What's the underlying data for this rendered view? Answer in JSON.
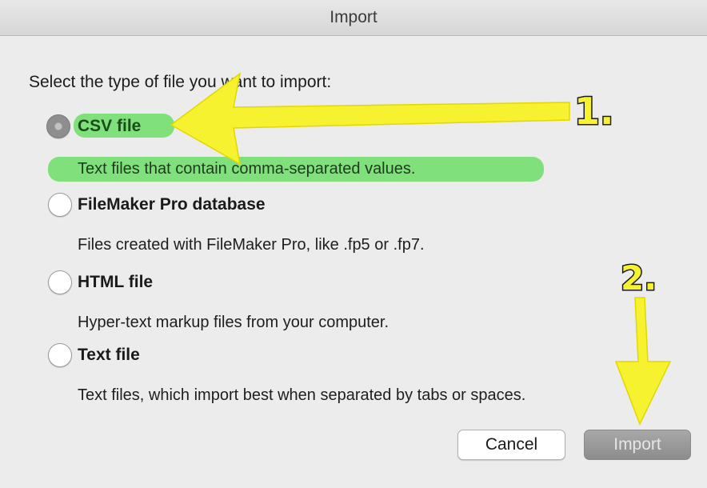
{
  "window": {
    "title": "Import"
  },
  "dialog": {
    "prompt": "Select the type of file you want to import:",
    "options": [
      {
        "title": "CSV file",
        "description": "Text files that contain comma-separated values.",
        "selected": true
      },
      {
        "title": "FileMaker Pro database",
        "description": "Files created with FileMaker Pro, like .fp5 or .fp7.",
        "selected": false
      },
      {
        "title": "HTML file",
        "description": "Hyper-text markup files from your computer.",
        "selected": false
      },
      {
        "title": "Text file",
        "description": "Text files, which import best when separated by tabs or spaces.",
        "selected": false
      }
    ],
    "buttons": {
      "cancel": "Cancel",
      "import": "Import"
    }
  },
  "annotations": {
    "step1": "1.",
    "step2": "2.",
    "highlight_color": "#7fe07c",
    "arrow_color": "#f6f230"
  }
}
